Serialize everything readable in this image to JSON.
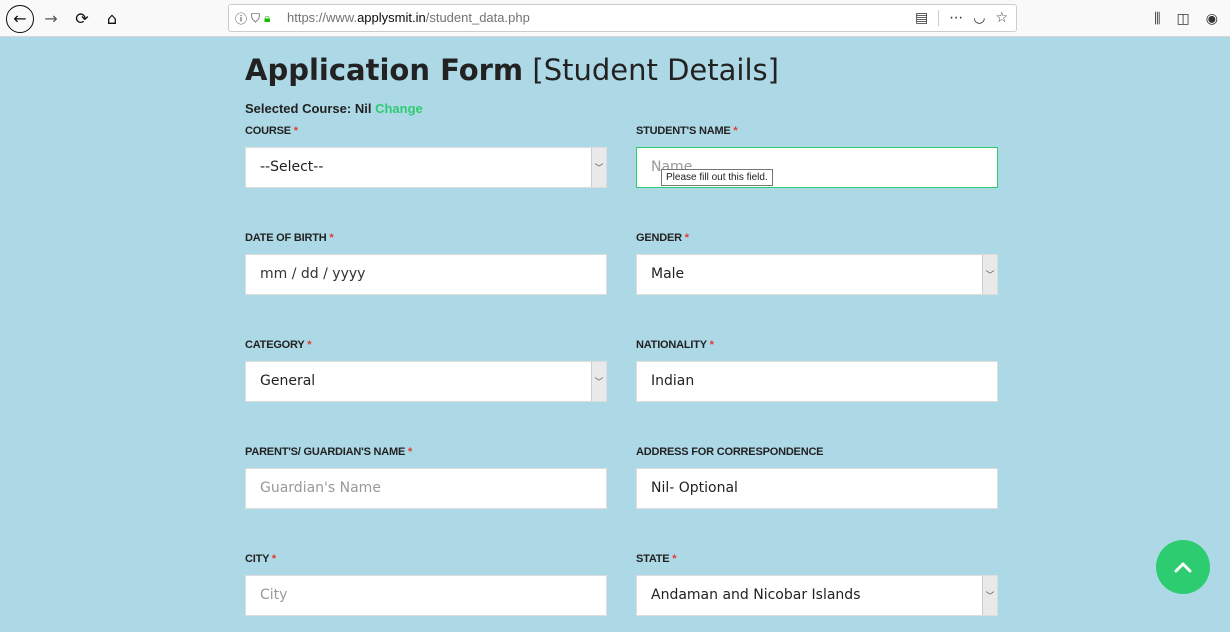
{
  "browser": {
    "url_prefix": "https://www.",
    "url_domain": "applysmit.in",
    "url_path": "/student_data.php"
  },
  "icons": {
    "back": "back-arrow-icon",
    "forward": "forward-arrow-icon",
    "reload": "reload-icon",
    "home": "home-icon",
    "info": "info-icon",
    "tracking": "tracking-protection-icon",
    "lock": "lock-icon",
    "reader": "reader-view-icon",
    "more": "more-actions-icon",
    "pocket": "pocket-icon",
    "bookmark": "bookmark-star-icon",
    "library": "library-icon",
    "sidebar": "sidebar-icon",
    "account": "account-icon",
    "scroll_top": "chevron-up-icon"
  },
  "colors": {
    "page_bg": "#add8e6",
    "accent": "#2ecc71",
    "required": "#e53935"
  },
  "form": {
    "title_bold": "Application Form",
    "title_sub": "[Student Details]",
    "selected_course_label": "Selected Course: Nil",
    "change_label": "Change",
    "required_mark": "*",
    "fields": {
      "course": {
        "label": "COURSE",
        "value": "--Select--"
      },
      "student_name": {
        "label": "STUDENT'S NAME",
        "placeholder": "Name"
      },
      "dob": {
        "label": "DATE OF BIRTH",
        "placeholder": "mm / dd / yyyy"
      },
      "gender": {
        "label": "GENDER",
        "value": "Male"
      },
      "category": {
        "label": "CATEGORY",
        "value": "General"
      },
      "nationality": {
        "label": "NATIONALITY",
        "value": "Indian"
      },
      "guardian": {
        "label": "PARENT'S/ GUARDIAN'S NAME",
        "placeholder": "Guardian's Name"
      },
      "address": {
        "label": "ADDRESS FOR CORRESPONDENCE",
        "value": "Nil- Optional"
      },
      "city": {
        "label": "CITY",
        "placeholder": "City"
      },
      "state": {
        "label": "STATE",
        "value": "Andaman and Nicobar Islands"
      }
    },
    "tooltip": "Please fill out this field."
  }
}
